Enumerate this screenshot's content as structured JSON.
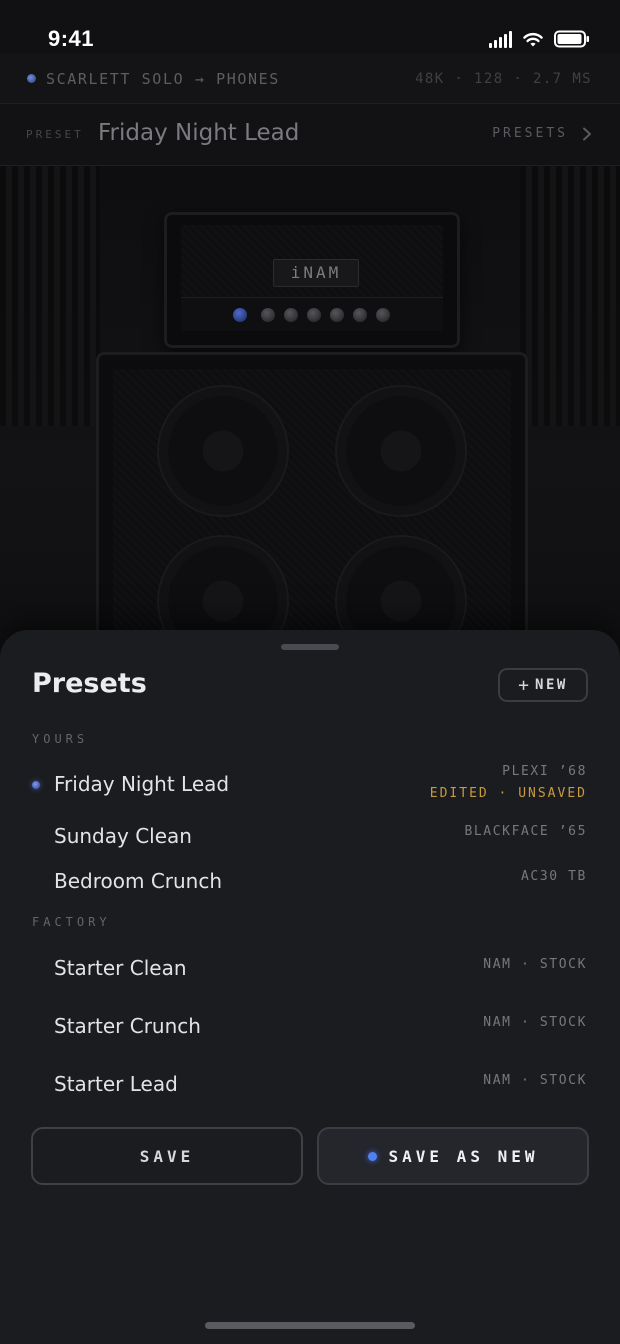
{
  "status_bar": {
    "time": "9:41"
  },
  "device_bar": {
    "device": "SCARLETT SOLO → PHONES",
    "stats": "48K · 128 · 2.7 MS"
  },
  "preset_header": {
    "label": "PRESET",
    "name": "Friday Night Lead",
    "presets_link": "PRESETS"
  },
  "amp": {
    "logo": "iNAM"
  },
  "sheet": {
    "title": "Presets",
    "new_label": "NEW",
    "yours_label": "YOURS",
    "factory_label": "FACTORY",
    "yours": [
      {
        "name": "Friday Night Lead",
        "model": "PLEXI ’68",
        "status": "EDITED · UNSAVED",
        "active": true
      },
      {
        "name": "Sunday Clean",
        "model": "BLACKFACE ’65"
      },
      {
        "name": "Bedroom Crunch",
        "model": "AC30 TB"
      }
    ],
    "factory": [
      {
        "name": "Starter Clean",
        "model": "NAM · STOCK"
      },
      {
        "name": "Starter Crunch",
        "model": "NAM · STOCK"
      },
      {
        "name": "Starter Lead",
        "model": "NAM · STOCK"
      }
    ],
    "save_label": "SAVE",
    "save_as_new_label": "SAVE AS NEW"
  },
  "colors": {
    "accent": "#4f82f0",
    "warning": "#c79a3e",
    "sheet_bg": "#1b1c1f"
  }
}
